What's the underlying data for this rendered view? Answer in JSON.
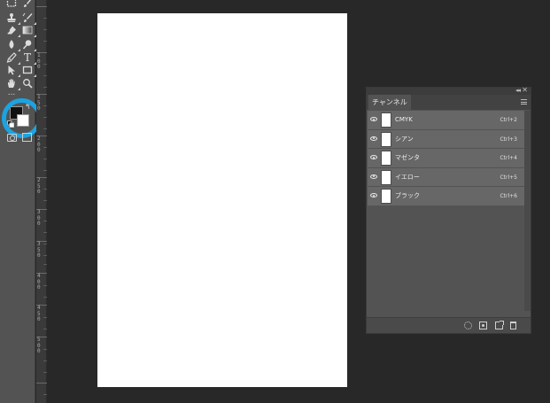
{
  "toolbar": {
    "tools": [
      {
        "id": "rect-marquee",
        "icon": "rect-marquee-icon"
      },
      {
        "id": "brush-dup",
        "icon": "brush-icon"
      },
      {
        "id": "stamp",
        "icon": "clone-stamp-icon"
      },
      {
        "id": "history-brush",
        "icon": "history-brush-icon"
      },
      {
        "id": "eraser",
        "icon": "eraser-icon"
      },
      {
        "id": "gradient",
        "icon": "gradient-icon"
      },
      {
        "id": "blur",
        "icon": "blur-icon"
      },
      {
        "id": "dodge",
        "icon": "dodge-icon"
      },
      {
        "id": "pen",
        "icon": "pen-icon"
      },
      {
        "id": "type",
        "icon": "type-icon",
        "label": "T"
      },
      {
        "id": "path-select",
        "icon": "path-select-icon"
      },
      {
        "id": "shape",
        "icon": "rectangle-shape-icon"
      },
      {
        "id": "hand",
        "icon": "hand-icon"
      },
      {
        "id": "zoom",
        "icon": "zoom-icon"
      }
    ],
    "more_label": "...",
    "foreground_color": "#111111",
    "background_color": "#ffffff",
    "highlight_color": "#1ca3e0"
  },
  "ruler": {
    "labels": [
      "1\n0\n0",
      "1\n5\n0",
      "2\n0\n0",
      "2\n5\n0",
      "3\n0\n0",
      "3\n5\n0",
      "4\n0\n0",
      "4\n5\n0",
      "5\n0\n0"
    ]
  },
  "channels_panel": {
    "tab_label": "チャンネル",
    "collapse_label": "◂◂",
    "close_label": "✕",
    "channels": [
      {
        "name": "CMYK",
        "shortcut": "Ctrl+2"
      },
      {
        "name": "シアン",
        "shortcut": "Ctrl+3"
      },
      {
        "name": "マゼンタ",
        "shortcut": "Ctrl+4"
      },
      {
        "name": "イエロー",
        "shortcut": "Ctrl+5"
      },
      {
        "name": "ブラック",
        "shortcut": "Ctrl+6"
      }
    ]
  }
}
